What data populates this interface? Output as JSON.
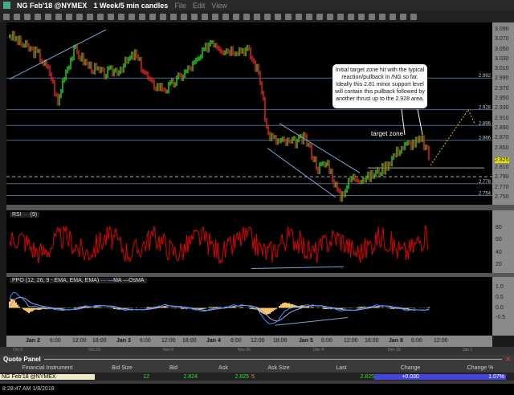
{
  "window": {
    "symbol": "NG Feb'18 @NYMEX",
    "interval": "1 Week/5 min candles",
    "menu": [
      "File",
      "Edit",
      "View"
    ]
  },
  "price_axis": {
    "ticks": [
      "3.090",
      "3.070",
      "3.050",
      "3.030",
      "3.010",
      "2.990",
      "2.970",
      "2.950",
      "2.930",
      "2.910",
      "2.890",
      "2.870",
      "2.850",
      "2.825",
      "2.810",
      "2.790",
      "2.770",
      "2.750"
    ],
    "current": "2.825",
    "current_color": "#e6e600"
  },
  "levels": [
    "2.992",
    "2.928",
    "2.896",
    "2.866",
    "2.778",
    "2.754"
  ],
  "annotations": {
    "note": "Initial target zone hit with the typical reaction/pullback in /NG so far. Ideally this 2.81 minor support level will contain this pullback followed by another thrust up to the 2.928 area.",
    "target_zone": "target zone"
  },
  "rsi": {
    "label": "RSI",
    "param": "(9)",
    "ticks": [
      "80",
      "60",
      "40",
      "20"
    ]
  },
  "ppo": {
    "label": "PPO",
    "params": "(12, 26, 9 - EMA, EMA, EMA)",
    "legend": [
      "MA",
      "OsMA"
    ],
    "ticks": [
      "1.0",
      "0.5",
      "0.0",
      "-0.5"
    ]
  },
  "time_axis": [
    "Jan 2",
    "6:00",
    "12:00",
    "18:00",
    "Jan 3",
    "6:00",
    "12:00",
    "18:00",
    "Jan 4",
    "6:00",
    "12:00",
    "18:00",
    "Jan 5",
    "6:00",
    "12:00",
    "18:00",
    "Jan 8",
    "6:00",
    "12:00"
  ],
  "overview_axis": [
    "Oct 9",
    "Oct 23",
    "Nov 6",
    "Nov 20",
    "Dec 4",
    "Dec 18",
    "Jan 1"
  ],
  "quote_panel": {
    "title": "Quote Panel",
    "columns": [
      "Financial Instrument",
      "Bid Size",
      "Bid",
      "Ask",
      "Ask Size",
      "Last",
      "Change",
      "Change %"
    ],
    "row": {
      "instrument": "NG Feb'18 @NYMEX",
      "bid_size": "12",
      "bid": "2.824",
      "ask": "2.825",
      "ask_size": "5",
      "last": "2.825",
      "change": "+0.030",
      "change_pct": "1.07%"
    }
  },
  "status": "8:28:47 AM 1/8/2018"
}
